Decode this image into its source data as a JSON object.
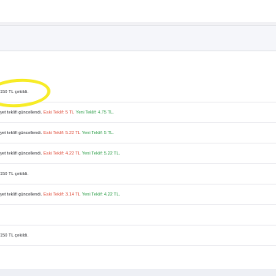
{
  "rows": [
    {
      "main": "150 TL çekildi."
    },
    {
      "main": "yet teklifi güncellendi.",
      "old": "Eski Teklif: 5 TL",
      "new": "Yeni Teklif: 4.75 TL."
    },
    {
      "main": "yet teklifi güncellendi.",
      "old": "Eski Teklif: 5.22 TL",
      "new": "Yeni Teklif: 5 TL."
    },
    {
      "main": "yet teklifi güncellendi.",
      "old": "Eski Teklif: 4.22 TL",
      "new": "Yeni Teklif: 5.22 TL."
    },
    {
      "main": "150 TL çekildi."
    },
    {
      "main": "yet teklifi güncellendi.",
      "old": "Eski Teklif: 3.14 TL",
      "new": "Yeni Teklif: 4.22 TL."
    },
    {
      "main": ""
    },
    {
      "main": "150 TL çekildi."
    }
  ]
}
